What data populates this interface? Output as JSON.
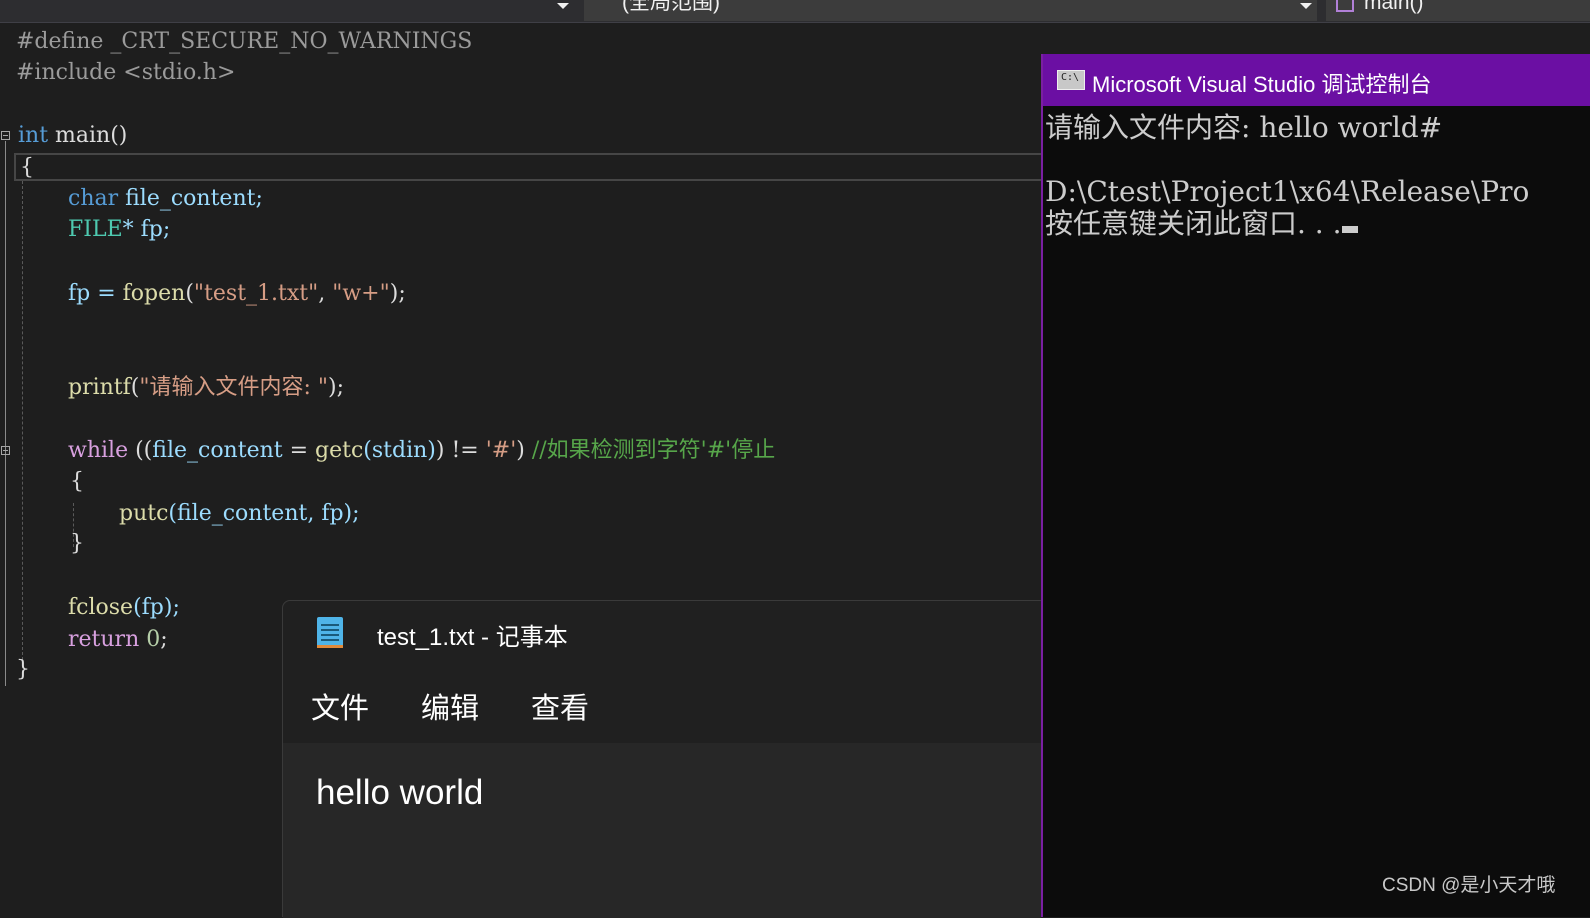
{
  "navbar": {
    "scope_dropdown": "(全局范围)",
    "function_dropdown": "main()"
  },
  "code": {
    "line1": "#define _CRT_SECURE_NO_WARNINGS",
    "line2": "#include <stdio.h>",
    "int": "int",
    "main": " main()",
    "brace_open": "{",
    "char_kw": "char",
    "char_rest": " file_content;",
    "file_type": "FILE",
    "file_rest": "* fp;",
    "fp_assign": "fp = ",
    "fopen": "fopen",
    "fopen_open": "(",
    "fopen_arg1": "\"test_1.txt\"",
    "comma": ", ",
    "fopen_arg2": "\"w+\"",
    "fopen_close": ");",
    "printf": "printf",
    "printf_open": "(",
    "printf_arg": "\"请输入文件内容: \"",
    "printf_close": ");",
    "while_kw": "while",
    "while_p1": " ((",
    "while_var": "file_content",
    "while_eq": " = ",
    "getc": "getc",
    "getc_arg": "(stdin)",
    "while_ne": ") != ",
    "char_lit": "'#'",
    "while_end": ") ",
    "comment": "//如果检测到字符'#'停止",
    "brace_open2": "{",
    "putc": "putc",
    "putc_args": "(file_content, fp);",
    "brace_close2": "}",
    "fclose": "fclose",
    "fclose_args": "(fp);",
    "return_kw": "return",
    "return_val": " 0",
    "semi": ";",
    "brace_close": "}"
  },
  "console": {
    "title": "Microsoft Visual Studio 调试控制台",
    "line1": "请输入文件内容: hello world#",
    "line2": "D:\\Ctest\\Project1\\x64\\Release\\Pro",
    "line3": "按任意键关闭此窗口. . ."
  },
  "notepad": {
    "title": "test_1.txt - 记事本",
    "menu": [
      "文件",
      "编辑",
      "查看"
    ],
    "content": "hello world"
  },
  "watermark": "CSDN @是小天才哦"
}
